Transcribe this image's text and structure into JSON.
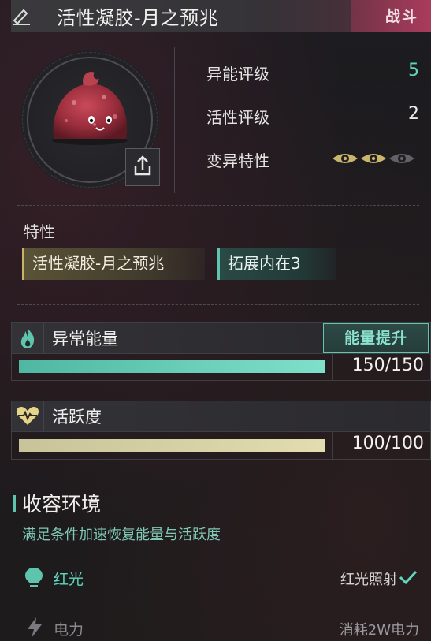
{
  "header": {
    "title": "活性凝胶-月之预兆",
    "tag": "战斗"
  },
  "stats": {
    "ability_rating_label": "异能评级",
    "ability_rating_value": "5",
    "activity_rating_label": "活性评级",
    "activity_rating_value": "2",
    "mutation_label": "变异特性",
    "mutation_active": 2,
    "mutation_total": 3
  },
  "traits": {
    "section_label": "特性",
    "items": [
      {
        "label": "活性凝胶-月之预兆",
        "style": "gold"
      },
      {
        "label": "拓展内在3",
        "style": "teal"
      }
    ]
  },
  "energy": {
    "label": "异常能量",
    "boost_label": "能量提升",
    "current": 150,
    "max": 150,
    "display": "150/150"
  },
  "activity": {
    "label": "活跃度",
    "current": 100,
    "max": 100,
    "display": "100/100"
  },
  "environment": {
    "title": "收容环境",
    "description": "满足条件加速恢复能量与活跃度",
    "rows": [
      {
        "label": "红光",
        "value": "红光照射",
        "satisfied": true,
        "icon": "lightbulb-icon"
      },
      {
        "label": "电力",
        "value": "消耗2W电力",
        "satisfied": false,
        "icon": "lightning-icon"
      }
    ]
  },
  "colors": {
    "teal": "#5ec4ad",
    "gold": "#c7b46a",
    "accent_pink": "#d14a78"
  }
}
